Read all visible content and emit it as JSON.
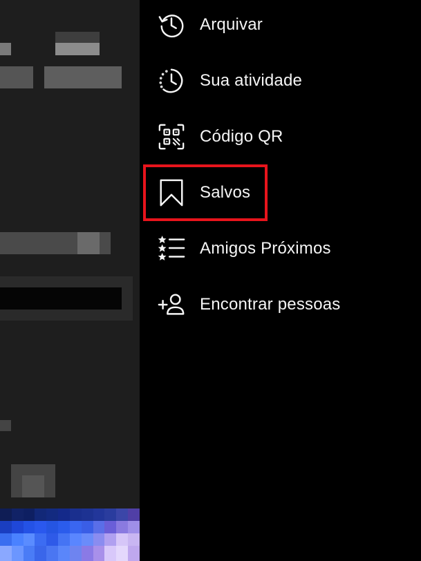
{
  "colors": {
    "drawer_background": "#000000",
    "behind_panel_background": "#1e1e1e",
    "menu_text": "#f5f5f5",
    "highlight_box": "#e8141c"
  },
  "menu": {
    "items": [
      {
        "label": "Arquivar",
        "icon": "archive-history-icon"
      },
      {
        "label": "Sua atividade",
        "icon": "activity-clock-icon"
      },
      {
        "label": "Código QR",
        "icon": "qr-code-icon"
      },
      {
        "label": "Salvos",
        "icon": "bookmark-icon",
        "highlighted": true
      },
      {
        "label": "Amigos Próximos",
        "icon": "close-friends-list-icon"
      },
      {
        "label": "Encontrar pessoas",
        "icon": "add-person-icon"
      }
    ]
  }
}
